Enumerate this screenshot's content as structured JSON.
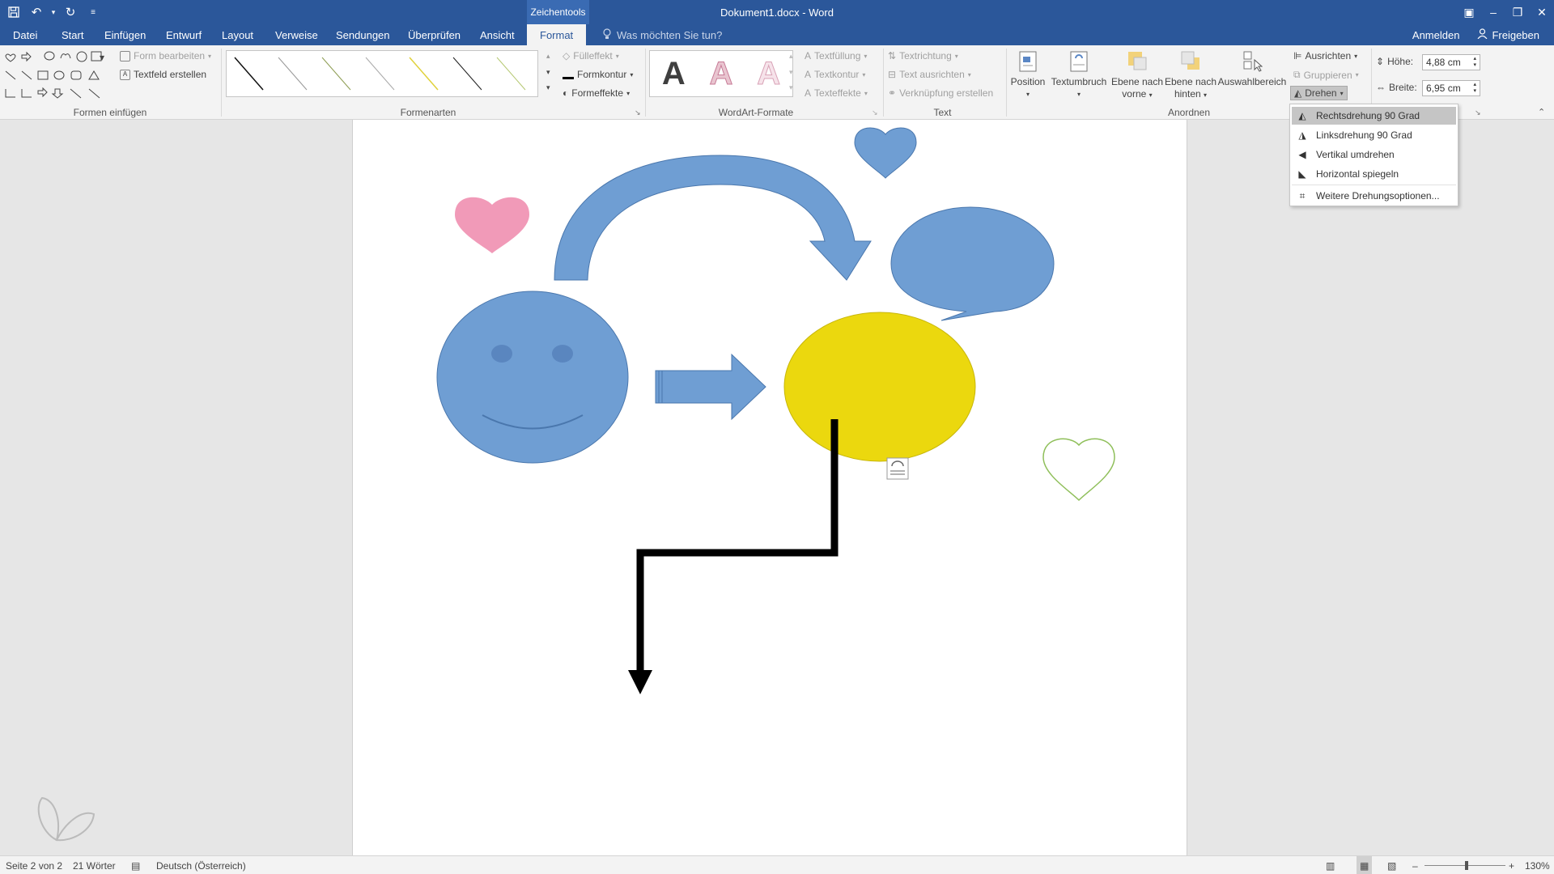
{
  "titlebar": {
    "context_tab": "Zeichentools",
    "document_title": "Dokument1.docx - Word"
  },
  "tabs": [
    {
      "label": "Datei"
    },
    {
      "label": "Start"
    },
    {
      "label": "Einfügen"
    },
    {
      "label": "Entwurf"
    },
    {
      "label": "Layout"
    },
    {
      "label": "Verweise"
    },
    {
      "label": "Sendungen"
    },
    {
      "label": "Überprüfen"
    },
    {
      "label": "Ansicht"
    },
    {
      "label": "Format"
    }
  ],
  "tell_me": "Was möchten Sie tun?",
  "account": {
    "sign_in": "Anmelden",
    "share": "Freigeben"
  },
  "ribbon": {
    "insert_shapes": {
      "edit_shape": "Form bearbeiten",
      "textbox": "Textfeld erstellen",
      "label": "Formen einfügen"
    },
    "shape_styles": {
      "fill": "Fülleffekt",
      "outline": "Formkontur",
      "effects": "Formeffekte",
      "label": "Formenarten"
    },
    "wordart": {
      "text_fill": "Textfüllung",
      "text_outline": "Textkontur",
      "text_effects": "Texteffekte",
      "label": "WordArt-Formate",
      "letter": "A"
    },
    "text": {
      "direction": "Textrichtung",
      "align": "Text ausrichten",
      "link": "Verknüpfung erstellen",
      "label": "Text"
    },
    "arrange": {
      "position": "Position",
      "wrap": "Textumbruch",
      "forward_1": "Ebene nach",
      "forward_2": "vorne",
      "backward_1": "Ebene nach",
      "backward_2": "hinten",
      "selection_pane": "Auswahlbereich",
      "align": "Ausrichten",
      "group": "Gruppieren",
      "rotate": "Drehen",
      "label": "Anordnen"
    },
    "size": {
      "height_label": "Höhe:",
      "height_value": "4,88 cm",
      "width_label": "Breite:",
      "width_value": "6,95 cm"
    }
  },
  "rotate_menu": [
    {
      "label": "Rechtsdrehung 90 Grad"
    },
    {
      "label": "Linksdrehung 90 Grad"
    },
    {
      "label": "Vertikal umdrehen"
    },
    {
      "label": "Horizontal spiegeln"
    },
    {
      "label": "Weitere Drehungsoptionen..."
    }
  ],
  "status": {
    "page": "Seite 2 von 2",
    "words": "21 Wörter",
    "language": "Deutsch (Österreich)",
    "zoom": "130%"
  },
  "colors": {
    "brand": "#2b579a",
    "shape_blue": "#6f9ed3",
    "shape_yellow": "#ebd80e",
    "pink_heart": "#ef8fb0",
    "outline_heart": "#8fbf5a"
  }
}
